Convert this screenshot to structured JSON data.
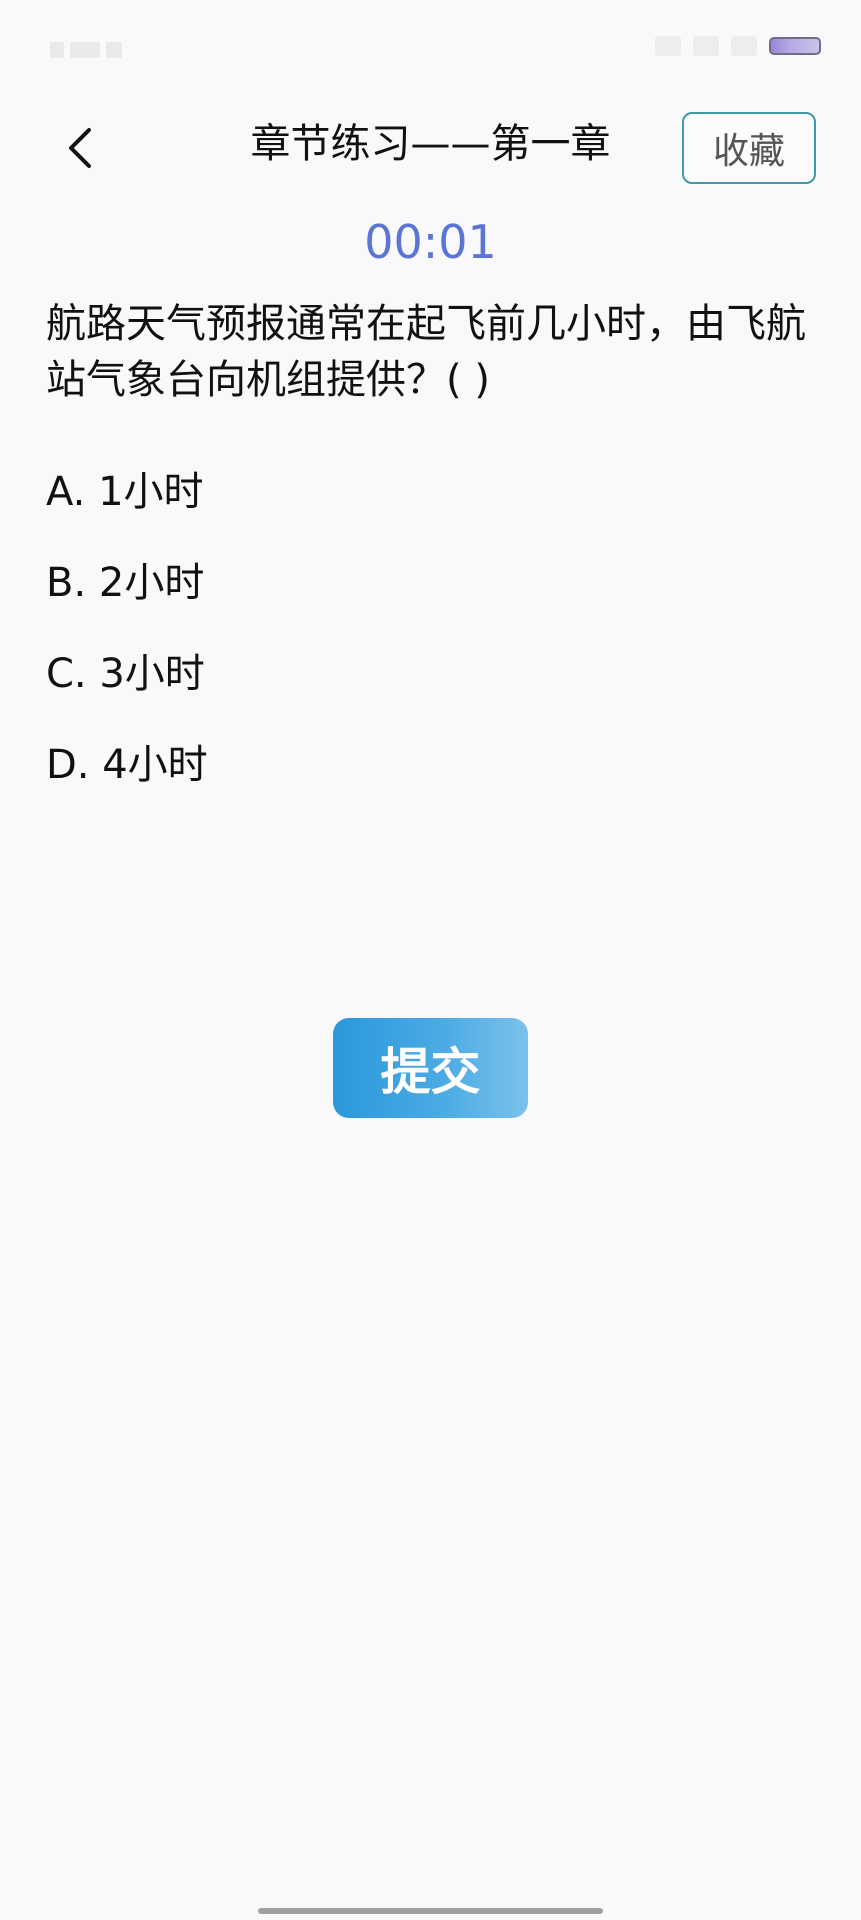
{
  "header": {
    "title": "章节练习——第一章",
    "favorite_label": "收藏"
  },
  "timer": "00:01",
  "question": {
    "text": "航路天气预报通常在起飞前几小时，由飞航站气象台向机组提供？( )",
    "options": [
      {
        "label": "A. 1小时"
      },
      {
        "label": "B. 2小时"
      },
      {
        "label": "C. 3小时"
      },
      {
        "label": "D. 4小时"
      }
    ]
  },
  "submit_label": "提交",
  "colors": {
    "timer": "#5b75d4",
    "favorite_border": "#3f9aa6",
    "submit_start": "#2a98dc",
    "submit_end": "#7cc1ec"
  }
}
